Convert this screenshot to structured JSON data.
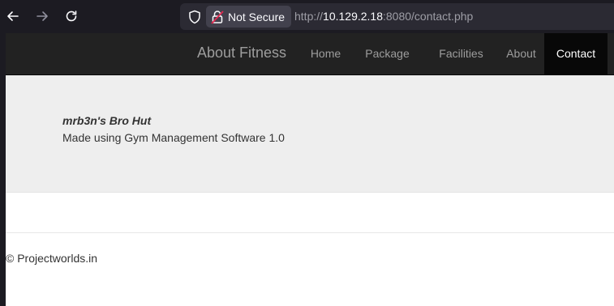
{
  "browser": {
    "security_label": "Not Secure",
    "url_prefix": "http://",
    "url_host": "10.129.2.18",
    "url_rest": ":8080/contact.php"
  },
  "navbar": {
    "brand": "About Fitness",
    "items": [
      {
        "label": "Home",
        "active": false
      },
      {
        "label": "Package",
        "active": false
      },
      {
        "label": "Facilities",
        "active": false
      },
      {
        "label": "About",
        "active": false
      },
      {
        "label": "Contact",
        "active": true
      }
    ]
  },
  "jumbotron": {
    "title": "mrb3n's Bro Hut",
    "text": "Made using Gym Management Software 1.0"
  },
  "footer": {
    "text": "© Projectworlds.in"
  },
  "colors": {
    "navbar_bg": "#222222",
    "nav_active_bg": "#080808",
    "jumbotron_bg": "#eeeeee"
  }
}
